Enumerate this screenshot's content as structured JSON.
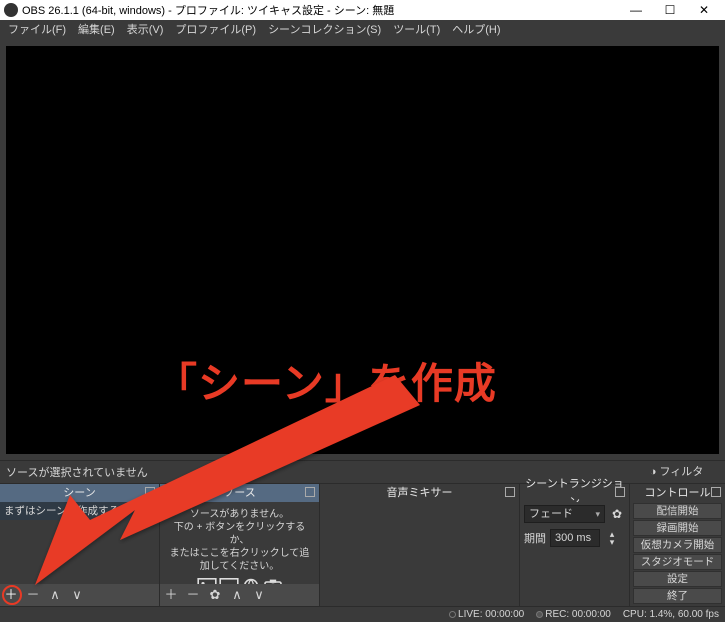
{
  "window": {
    "title": "OBS 26.1.1 (64-bit, windows) - プロファイル: ツイキャス設定 - シーン: 無題"
  },
  "menu": {
    "file": "ファイル(F)",
    "edit": "編集(E)",
    "view": "表示(V)",
    "profile": "プロファイル(P)",
    "scenecol": "シーンコレクション(S)",
    "tools": "ツール(T)",
    "help": "ヘルプ(H)"
  },
  "srcbar": {
    "msg": "ソースが選択されていません",
    "filter": "フィルタ"
  },
  "docks": {
    "scenes": {
      "title": "シーン",
      "empty": "まずはシーンを作成する"
    },
    "sources": {
      "title": "ソース",
      "hint1": "ソースがありません。",
      "hint2": "下の + ボタンをクリックするか、",
      "hint3": "またはここを右クリックして追加してください。"
    },
    "mixer": {
      "title": "音声ミキサー"
    },
    "trans": {
      "title": "シーントランジション",
      "fade": "フェード",
      "duration_label": "期間",
      "duration_value": "300 ms"
    },
    "ctrl": {
      "title": "コントロール",
      "b0": "配信開始",
      "b1": "録画開始",
      "b2": "仮想カメラ開始",
      "b3": "スタジオモード",
      "b4": "設定",
      "b5": "終了"
    }
  },
  "status": {
    "live": "LIVE: 00:00:00",
    "rec": "REC: 00:00:00",
    "cpu": "CPU: 1.4%, 60.00 fps"
  },
  "annotation": {
    "text": "「シーン」を作成"
  }
}
